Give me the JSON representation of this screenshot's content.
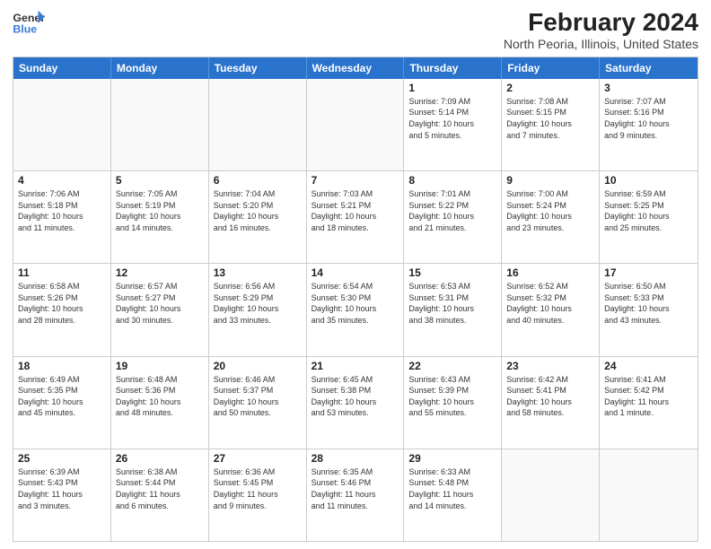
{
  "logo": {
    "text_general": "General",
    "text_blue": "Blue"
  },
  "header": {
    "title": "February 2024",
    "subtitle": "North Peoria, Illinois, United States"
  },
  "days_of_week": [
    "Sunday",
    "Monday",
    "Tuesday",
    "Wednesday",
    "Thursday",
    "Friday",
    "Saturday"
  ],
  "weeks": [
    [
      {
        "day": "",
        "info": ""
      },
      {
        "day": "",
        "info": ""
      },
      {
        "day": "",
        "info": ""
      },
      {
        "day": "",
        "info": ""
      },
      {
        "day": "1",
        "info": "Sunrise: 7:09 AM\nSunset: 5:14 PM\nDaylight: 10 hours\nand 5 minutes."
      },
      {
        "day": "2",
        "info": "Sunrise: 7:08 AM\nSunset: 5:15 PM\nDaylight: 10 hours\nand 7 minutes."
      },
      {
        "day": "3",
        "info": "Sunrise: 7:07 AM\nSunset: 5:16 PM\nDaylight: 10 hours\nand 9 minutes."
      }
    ],
    [
      {
        "day": "4",
        "info": "Sunrise: 7:06 AM\nSunset: 5:18 PM\nDaylight: 10 hours\nand 11 minutes."
      },
      {
        "day": "5",
        "info": "Sunrise: 7:05 AM\nSunset: 5:19 PM\nDaylight: 10 hours\nand 14 minutes."
      },
      {
        "day": "6",
        "info": "Sunrise: 7:04 AM\nSunset: 5:20 PM\nDaylight: 10 hours\nand 16 minutes."
      },
      {
        "day": "7",
        "info": "Sunrise: 7:03 AM\nSunset: 5:21 PM\nDaylight: 10 hours\nand 18 minutes."
      },
      {
        "day": "8",
        "info": "Sunrise: 7:01 AM\nSunset: 5:22 PM\nDaylight: 10 hours\nand 21 minutes."
      },
      {
        "day": "9",
        "info": "Sunrise: 7:00 AM\nSunset: 5:24 PM\nDaylight: 10 hours\nand 23 minutes."
      },
      {
        "day": "10",
        "info": "Sunrise: 6:59 AM\nSunset: 5:25 PM\nDaylight: 10 hours\nand 25 minutes."
      }
    ],
    [
      {
        "day": "11",
        "info": "Sunrise: 6:58 AM\nSunset: 5:26 PM\nDaylight: 10 hours\nand 28 minutes."
      },
      {
        "day": "12",
        "info": "Sunrise: 6:57 AM\nSunset: 5:27 PM\nDaylight: 10 hours\nand 30 minutes."
      },
      {
        "day": "13",
        "info": "Sunrise: 6:56 AM\nSunset: 5:29 PM\nDaylight: 10 hours\nand 33 minutes."
      },
      {
        "day": "14",
        "info": "Sunrise: 6:54 AM\nSunset: 5:30 PM\nDaylight: 10 hours\nand 35 minutes."
      },
      {
        "day": "15",
        "info": "Sunrise: 6:53 AM\nSunset: 5:31 PM\nDaylight: 10 hours\nand 38 minutes."
      },
      {
        "day": "16",
        "info": "Sunrise: 6:52 AM\nSunset: 5:32 PM\nDaylight: 10 hours\nand 40 minutes."
      },
      {
        "day": "17",
        "info": "Sunrise: 6:50 AM\nSunset: 5:33 PM\nDaylight: 10 hours\nand 43 minutes."
      }
    ],
    [
      {
        "day": "18",
        "info": "Sunrise: 6:49 AM\nSunset: 5:35 PM\nDaylight: 10 hours\nand 45 minutes."
      },
      {
        "day": "19",
        "info": "Sunrise: 6:48 AM\nSunset: 5:36 PM\nDaylight: 10 hours\nand 48 minutes."
      },
      {
        "day": "20",
        "info": "Sunrise: 6:46 AM\nSunset: 5:37 PM\nDaylight: 10 hours\nand 50 minutes."
      },
      {
        "day": "21",
        "info": "Sunrise: 6:45 AM\nSunset: 5:38 PM\nDaylight: 10 hours\nand 53 minutes."
      },
      {
        "day": "22",
        "info": "Sunrise: 6:43 AM\nSunset: 5:39 PM\nDaylight: 10 hours\nand 55 minutes."
      },
      {
        "day": "23",
        "info": "Sunrise: 6:42 AM\nSunset: 5:41 PM\nDaylight: 10 hours\nand 58 minutes."
      },
      {
        "day": "24",
        "info": "Sunrise: 6:41 AM\nSunset: 5:42 PM\nDaylight: 11 hours\nand 1 minute."
      }
    ],
    [
      {
        "day": "25",
        "info": "Sunrise: 6:39 AM\nSunset: 5:43 PM\nDaylight: 11 hours\nand 3 minutes."
      },
      {
        "day": "26",
        "info": "Sunrise: 6:38 AM\nSunset: 5:44 PM\nDaylight: 11 hours\nand 6 minutes."
      },
      {
        "day": "27",
        "info": "Sunrise: 6:36 AM\nSunset: 5:45 PM\nDaylight: 11 hours\nand 9 minutes."
      },
      {
        "day": "28",
        "info": "Sunrise: 6:35 AM\nSunset: 5:46 PM\nDaylight: 11 hours\nand 11 minutes."
      },
      {
        "day": "29",
        "info": "Sunrise: 6:33 AM\nSunset: 5:48 PM\nDaylight: 11 hours\nand 14 minutes."
      },
      {
        "day": "",
        "info": ""
      },
      {
        "day": "",
        "info": ""
      }
    ]
  ]
}
